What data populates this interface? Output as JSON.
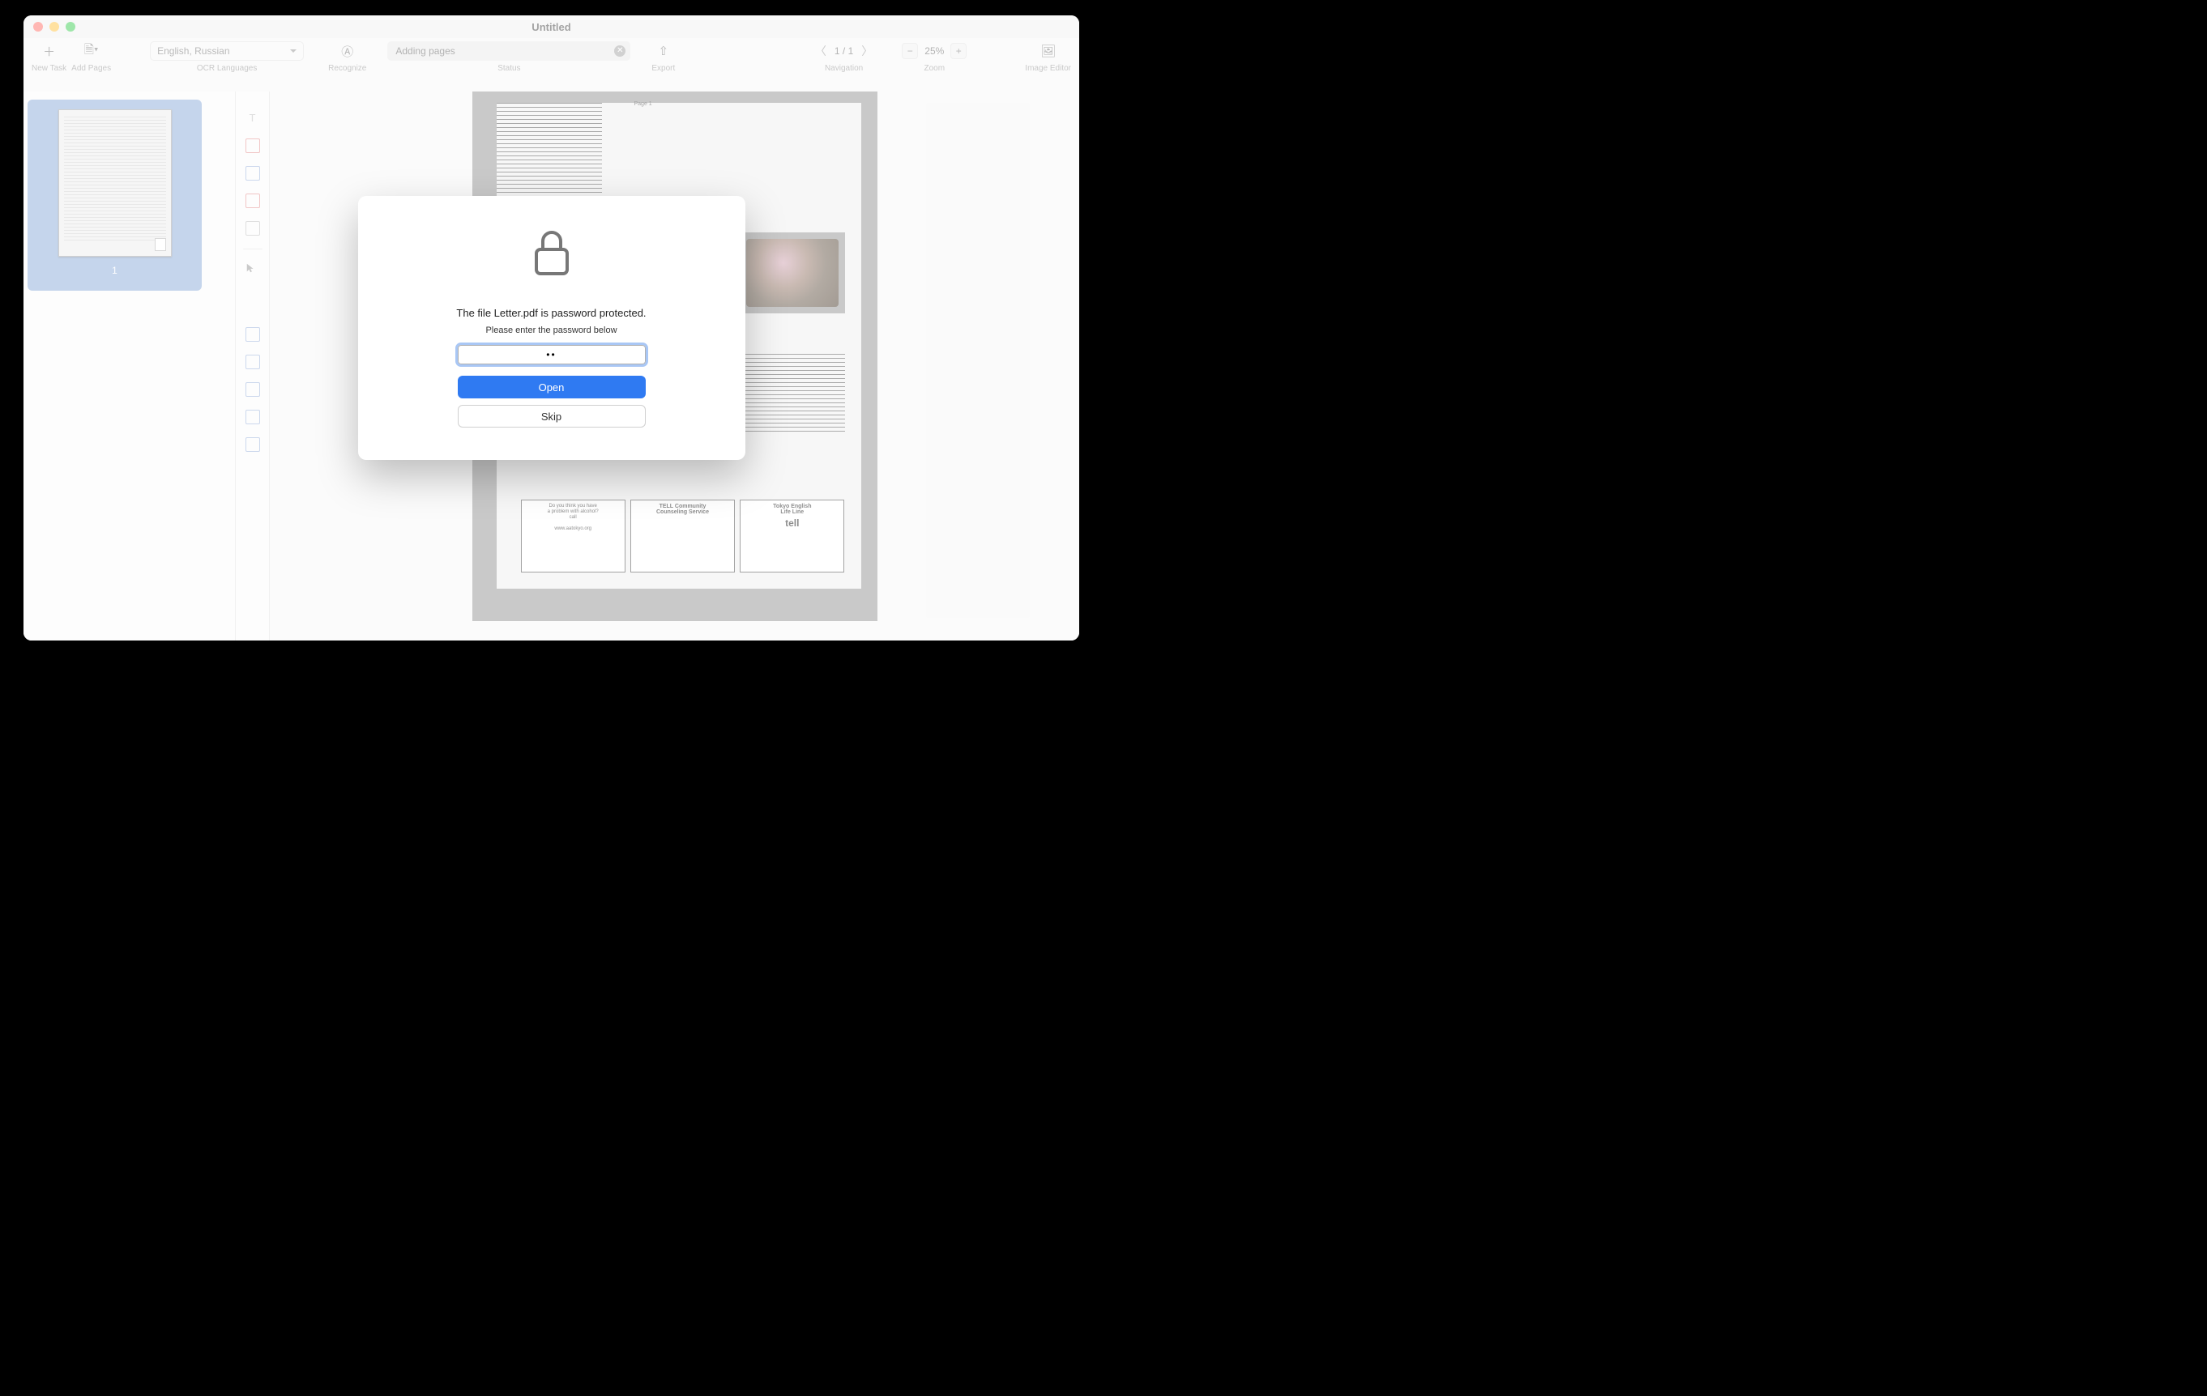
{
  "window": {
    "title": "Untitled"
  },
  "toolbar": {
    "new_task_label": "New Task",
    "add_pages_label": "Add Pages",
    "ocr_lang_value": "English, Russian",
    "ocr_lang_label": "OCR Languages",
    "recognize_label": "Recognize",
    "status_text": "Adding pages",
    "status_label": "Status",
    "export_label": "Export",
    "nav_value": "1 / 1",
    "nav_label": "Navigation",
    "zoom_value": "25%",
    "zoom_label": "Zoom",
    "image_editor_label": "Image Editor"
  },
  "thumbnails": {
    "page1_num": "1"
  },
  "document": {
    "page_label": "Page 1",
    "ads": {
      "a1_line1": "Do you think you have",
      "a1_line2": "a problem with alcohol?",
      "a1_line3": "call",
      "a1_line4": "www.aatokyo.org",
      "a2_line1": "TELL Community",
      "a2_line2": "Counseling Service",
      "a3_line1": "Tokyo English",
      "a3_line2": "Life Line",
      "a3_line3": "tell"
    }
  },
  "modal": {
    "message": "The file Letter.pdf is password protected.",
    "sub": "Please enter the password below",
    "password_value": "••",
    "open_label": "Open",
    "skip_label": "Skip"
  }
}
